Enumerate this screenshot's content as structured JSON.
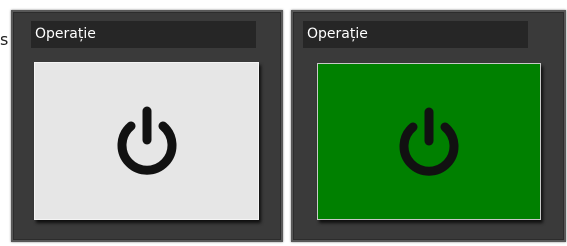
{
  "stray_text": "s",
  "panels": [
    {
      "header": "Operație",
      "state": "off",
      "button_color": "#e6e6e6",
      "icon": "power-icon"
    },
    {
      "header": "Operație",
      "state": "on",
      "button_color": "#008000",
      "icon": "power-icon"
    }
  ]
}
